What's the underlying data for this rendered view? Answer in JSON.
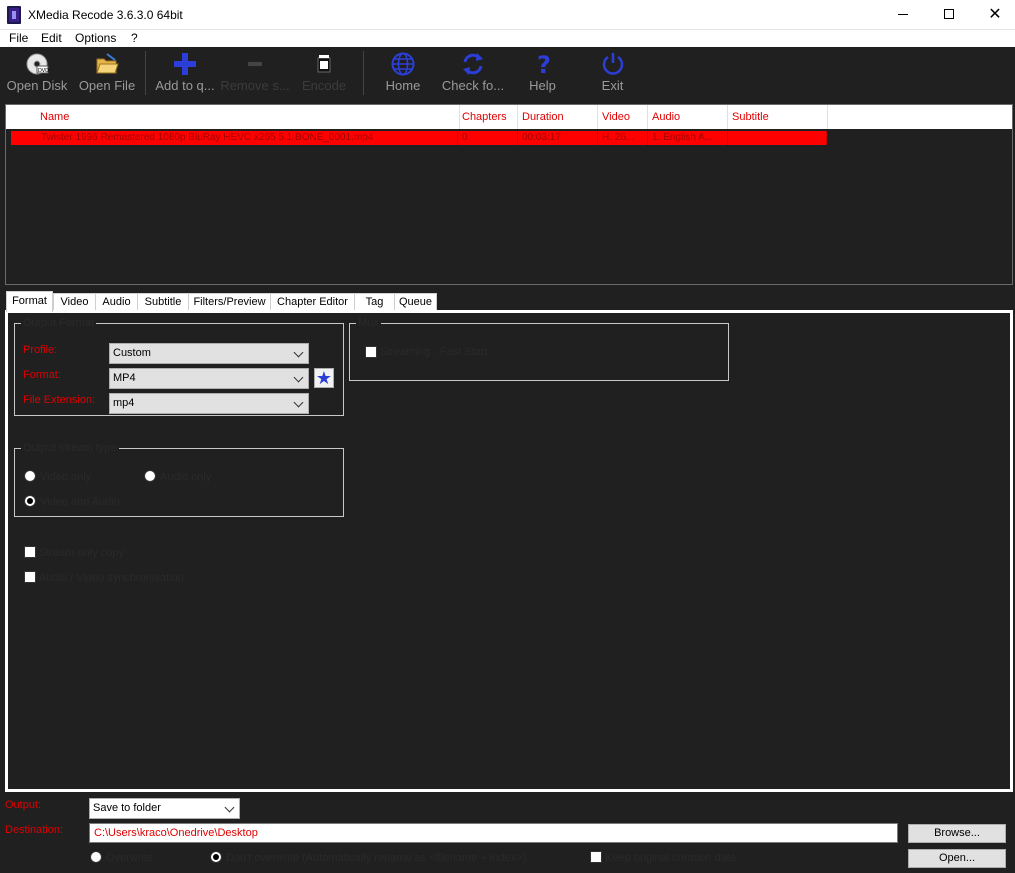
{
  "window": {
    "title": "XMedia Recode 3.6.3.0 64bit"
  },
  "menu": [
    "File",
    "Edit",
    "Options",
    "?"
  ],
  "toolbar": {
    "open_disk": "Open Disk",
    "open_file": "Open File",
    "add_to_queue": "Add to q...",
    "remove": "Remove s...",
    "encode": "Encode",
    "home": "Home",
    "check_for_updates": "Check fo...",
    "help": "Help",
    "exit": "Exit"
  },
  "filelist": {
    "columns": [
      "Name",
      "Chapters",
      "Duration",
      "Video",
      "Audio",
      "Subtitle"
    ],
    "rows": [
      {
        "name": "Twister 1996 Remastered 1080p BluRay HEVC x265 5.1 BONE_0001.mp4",
        "chapters": "0",
        "duration": "00:03:17",
        "video": "H. 26...",
        "audio": "1. English A...",
        "subtitle": ""
      }
    ]
  },
  "tabs": [
    "Format",
    "Video",
    "Audio",
    "Subtitle",
    "Filters/Preview",
    "Chapter Editor",
    "Tag",
    "Queue"
  ],
  "format_tab": {
    "output_format_legend": "Output Format",
    "profile_label": "Profile:",
    "profile_value": "Custom",
    "format_label": "Format:",
    "format_value": "MP4",
    "extension_label": "File Extension:",
    "extension_value": "mp4",
    "mux_legend": "Mux",
    "streaming_fast_start": "Streaming - Fast Start",
    "stream_type_legend": "Output stream type",
    "video_only": "Video only",
    "audio_only": "Audio only",
    "video_and_audio": "Video and Audio",
    "stream_only_copy": "Stream only copy",
    "av_sync": "Audio / Video synchronisation"
  },
  "bottom": {
    "output_label": "Output:",
    "output_value": "Save to folder",
    "destination_label": "Destination:",
    "destination_value": "C:\\Users\\kraco\\Onedrive\\Desktop",
    "browse_button": "Browse...",
    "open_button": "Open...",
    "overwrite": "Overwrite",
    "dont_overwrite": "Don't overwrite (Automatically rename as <filename + index>)",
    "keep_creation_date": "Keep original creation date"
  },
  "colors": {
    "accent_red": "#ff0000",
    "label_red": "#e00000",
    "icon_blue": "#2b3fd8"
  }
}
